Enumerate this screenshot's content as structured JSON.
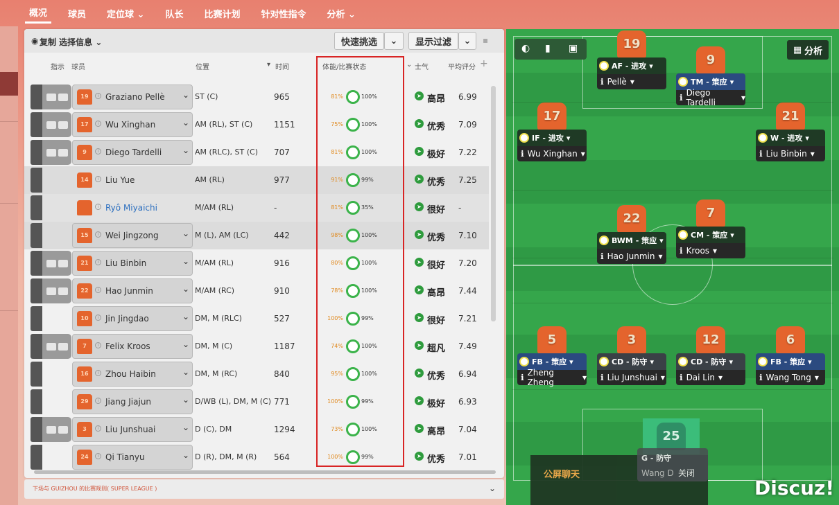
{
  "nav": {
    "tabs": [
      {
        "label": "概况",
        "active": true
      },
      {
        "label": "球员"
      },
      {
        "label": "定位球 ⌄"
      },
      {
        "label": "队长"
      },
      {
        "label": "比赛计划"
      },
      {
        "label": "针对性指令"
      },
      {
        "label": "分析 ⌄"
      }
    ]
  },
  "toolbar": {
    "copy_label": "复制 选择信息 ⌄",
    "quick_pick": "快速挑选",
    "display_filter": "显示过滤"
  },
  "columns": {
    "instr": "指示",
    "player": "球员",
    "position": "位置",
    "time": "时间",
    "fitness": "体能/比赛状态",
    "morale": "士气",
    "rating": "平均评分"
  },
  "rows": [
    {
      "num": "19",
      "name": "Graziano Pellè",
      "pos": "ST (C)",
      "time": "965",
      "fit": "81%",
      "cond": "100%",
      "morale": "高昂",
      "rating": "6.99"
    },
    {
      "num": "17",
      "name": "Wu Xinghan",
      "pos": "AM (RL), ST (C)",
      "time": "1151",
      "fit": "75%",
      "cond": "100%",
      "morale": "优秀",
      "rating": "7.09"
    },
    {
      "num": "9",
      "name": "Diego Tardelli",
      "pos": "AM (RLC), ST (C)",
      "time": "707",
      "fit": "81%",
      "cond": "100%",
      "morale": "极好",
      "rating": "7.22"
    },
    {
      "num": "14",
      "name": "Liu Yue",
      "pos": "AM (RL)",
      "time": "977",
      "fit": "91%",
      "cond": "99%",
      "morale": "优秀",
      "rating": "7.25"
    },
    {
      "num": "",
      "name": "Ryô Miyaichi",
      "pos": "M/AM (RL)",
      "time": "-",
      "fit": "81%",
      "cond": "35%",
      "morale": "很好",
      "rating": "-"
    },
    {
      "num": "15",
      "name": "Wei Jingzong",
      "pos": "M (L), AM (LC)",
      "time": "442",
      "fit": "98%",
      "cond": "100%",
      "morale": "优秀",
      "rating": "7.10"
    },
    {
      "num": "21",
      "name": "Liu Binbin",
      "pos": "M/AM (RL)",
      "time": "916",
      "fit": "80%",
      "cond": "100%",
      "morale": "很好",
      "rating": "7.20"
    },
    {
      "num": "22",
      "name": "Hao Junmin",
      "pos": "M/AM (RC)",
      "time": "910",
      "fit": "78%",
      "cond": "100%",
      "morale": "高昂",
      "rating": "7.44"
    },
    {
      "num": "10",
      "name": "Jin Jingdao",
      "pos": "DM, M (RLC)",
      "time": "527",
      "fit": "100%",
      "cond": "99%",
      "morale": "很好",
      "rating": "7.21"
    },
    {
      "num": "7",
      "name": "Felix Kroos",
      "pos": "DM, M (C)",
      "time": "1187",
      "fit": "74%",
      "cond": "100%",
      "morale": "超凡",
      "rating": "7.49"
    },
    {
      "num": "16",
      "name": "Zhou Haibin",
      "pos": "DM, M (RC)",
      "time": "840",
      "fit": "95%",
      "cond": "100%",
      "morale": "优秀",
      "rating": "6.94"
    },
    {
      "num": "29",
      "name": "Jiang Jiajun",
      "pos": "D/WB (L), DM, M (C)",
      "time": "771",
      "fit": "100%",
      "cond": "99%",
      "morale": "极好",
      "rating": "6.93"
    },
    {
      "num": "3",
      "name": "Liu Junshuai",
      "pos": "D (C), DM",
      "time": "1294",
      "fit": "73%",
      "cond": "100%",
      "morale": "高昂",
      "rating": "7.04"
    },
    {
      "num": "24",
      "name": "Qi Tianyu",
      "pos": "D (R), DM, M (R)",
      "time": "564",
      "fit": "100%",
      "cond": "99%",
      "morale": "优秀",
      "rating": "7.01"
    }
  ],
  "footer": {
    "next_match": "下场与 GUIZHOU 的比赛规则( SUPER LEAGUE )"
  },
  "pitch": {
    "analysis": "分析",
    "players": [
      {
        "num": "19",
        "role": "AF - 进攻",
        "name": "Pellè"
      },
      {
        "num": "9",
        "role": "TM - 策应",
        "name": "Diego Tardelli"
      },
      {
        "num": "17",
        "role": "IF - 进攻",
        "name": "Wu Xinghan"
      },
      {
        "num": "21",
        "role": "W - 进攻",
        "name": "Liu Binbin"
      },
      {
        "num": "22",
        "role": "BWM - 策应",
        "name": "Hao Junmin"
      },
      {
        "num": "7",
        "role": "CM - 策应",
        "name": "Kroos"
      },
      {
        "num": "5",
        "role": "FB - 策应",
        "name": "Zheng Zheng"
      },
      {
        "num": "3",
        "role": "CD - 防守",
        "name": "Liu Junshuai"
      },
      {
        "num": "12",
        "role": "CD - 防守",
        "name": "Dai Lin"
      },
      {
        "num": "6",
        "role": "FB - 策应",
        "name": "Wang Tong"
      }
    ],
    "gk": {
      "num": "25",
      "role": "G - 防守",
      "name": "Wang D",
      "close": "关闭"
    },
    "chat": "公屏聊天"
  },
  "brand": "Discuz!"
}
